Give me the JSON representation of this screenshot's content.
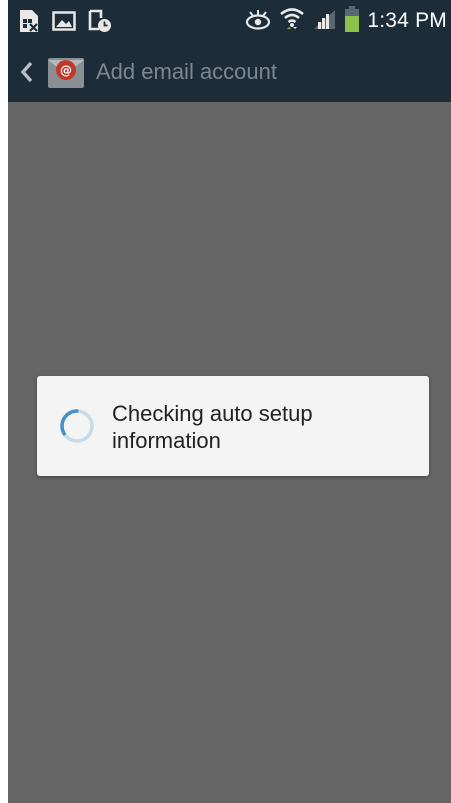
{
  "status_bar": {
    "time": "1:34 PM",
    "icons": [
      "sim-card-x-icon",
      "gallery-icon",
      "screenshot-timer-icon",
      "smart-stay-eye-icon",
      "wifi-icon",
      "signal-icon",
      "battery-icon"
    ]
  },
  "action_bar": {
    "back_icon": "chevron-left-icon",
    "app_icon": "email-app-icon",
    "title": "Add email account"
  },
  "dialog": {
    "message": "Checking auto setup information",
    "progress_icon": "progress-spinner-icon"
  },
  "colors": {
    "status_bar_bg": "#1c2c38",
    "dim_background": "#656565",
    "dialog_bg": "#f4f4f4",
    "spinner_accent": "#4a90c8",
    "battery_green": "#8bc34a"
  }
}
